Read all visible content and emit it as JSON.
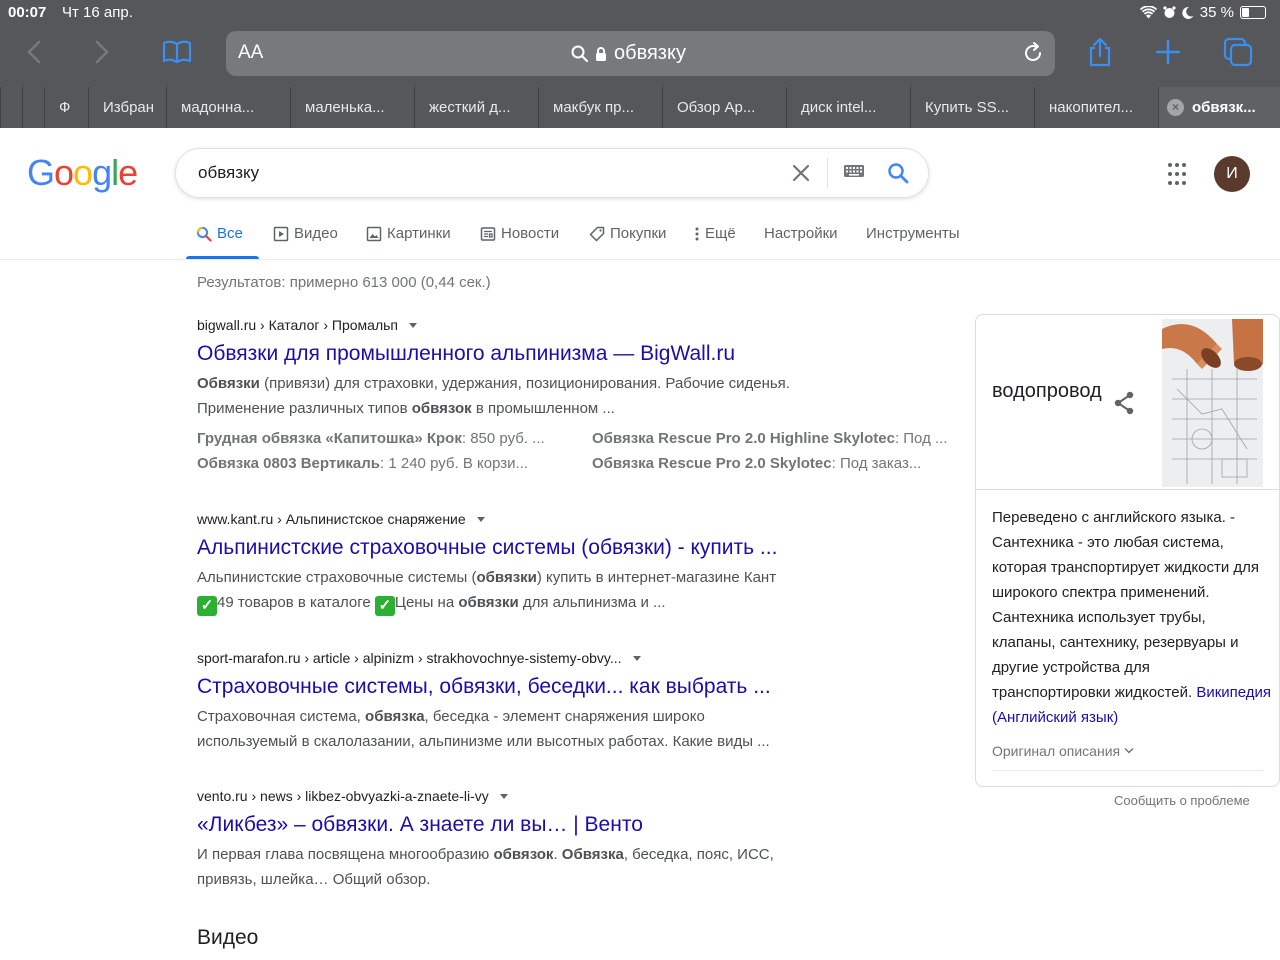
{
  "status": {
    "time": "00:07",
    "date": "Чт 16 апр.",
    "battery": "35 %",
    "battery_level": 0.35
  },
  "safari": {
    "aa_label": "AA",
    "url": "обвязку",
    "tabs": [
      "Ф",
      "Избран",
      "мадонна...",
      "маленька...",
      "жесткий д...",
      "макбук пр...",
      "Обзор Ap...",
      "диск intel...",
      "Купить SS...",
      "накопител...",
      "обвязк..."
    ],
    "active_tab_index": 10
  },
  "google": {
    "logo": "Google",
    "query": "обвязку",
    "avatar_letter": "И",
    "nav": [
      "Все",
      "Видео",
      "Картинки",
      "Новости",
      "Покупки",
      "Ещё",
      "Настройки",
      "Инструменты"
    ],
    "stats": "Результатов: примерно 613 000 (0,44 сек.)"
  },
  "results": [
    {
      "cite": "bigwall.ru › Каталог › Промальп",
      "title": "Обвязки для промышленного альпинизма — BigWall.ru",
      "snippet_lines": [
        [
          {
            "b": "Обвязки"
          },
          {
            "t": " (привязи) для страховки, удержания, позиционирования. Рабочие сиденья."
          }
        ],
        [
          {
            "t": "Применение различных типов "
          },
          {
            "b": "обвязок"
          },
          {
            "t": " в промышленном ..."
          }
        ]
      ],
      "sitelinks": [
        {
          "b": "Грудная обвязка «Капитошка» Крок",
          "t": ": 850 руб. ..."
        },
        {
          "b": "Обвязка Rescue Pro 2.0 Highline Skylotec",
          "t": ": Под ..."
        },
        {
          "b": "Обвязка 0803 Вертикаль",
          "t": ": 1 240 руб. В корзи..."
        },
        {
          "b": "Обвязка Rescue Pro 2.0 Skylotec",
          "t": ": Под заказ..."
        }
      ]
    },
    {
      "cite": "www.kant.ru › Альпинистское снаряжение",
      "title": "Альпинистские страховочные системы (обвязки) - купить ...",
      "snippet_lines": [
        [
          {
            "t": "Альпинистские страховочные системы ("
          },
          {
            "b": "обвязки"
          },
          {
            "t": ") купить в интернет-магазине Кант"
          }
        ],
        [
          {
            "check": "✓"
          },
          {
            "t": "49 товаров в каталоге "
          },
          {
            "check": "✓"
          },
          {
            "t": "Цены на "
          },
          {
            "b": "обвязки"
          },
          {
            "t": " для альпинизма и ..."
          }
        ]
      ]
    },
    {
      "cite": "sport-marafon.ru › article › alpinizm › strakhovochnye-sistemy-obvy...",
      "title": "Страховочные системы, обвязки, беседки... как выбрать ...",
      "snippet_lines": [
        [
          {
            "t": "Страховочная система, "
          },
          {
            "b": "обвязка"
          },
          {
            "t": ", беседка - элемент снаряжения широко"
          }
        ],
        [
          {
            "t": "используемый в скалолазании, альпинизме или высотных работах. Какие виды ..."
          }
        ]
      ]
    },
    {
      "cite": "vento.ru › news › likbez-obvyazki-a-znaete-li-vy",
      "title": "«Ликбез» – обвязки. А знаете ли вы… | Венто",
      "snippet_lines": [
        [
          {
            "t": "И первая глава посвящена многообразию "
          },
          {
            "b": "обвязок"
          },
          {
            "t": ". "
          },
          {
            "b": "Обвязка"
          },
          {
            "t": ", беседка, пояс, ИСС,"
          }
        ],
        [
          {
            "t": "привязь, шлейка… Общий обзор."
          }
        ]
      ]
    }
  ],
  "video_heading": "Видео",
  "knowledge_panel": {
    "title": "водопровод",
    "description": "Переведено с английского языка. - Сантехника - это любая система, которая транспортирует жидкости для широкого спектра применений. Сантехника использует трубы, клапаны, сантехнику, резервуары и другие устройства для транспортировки жидкостей.",
    "source_link": "Википедия (Английский язык)",
    "original_label": "Оригинал описания",
    "report": "Сообщить о проблеме"
  },
  "colors": {
    "link": "#1a0dab",
    "accent": "#1a73e8",
    "safari_bar": "#55575b"
  }
}
